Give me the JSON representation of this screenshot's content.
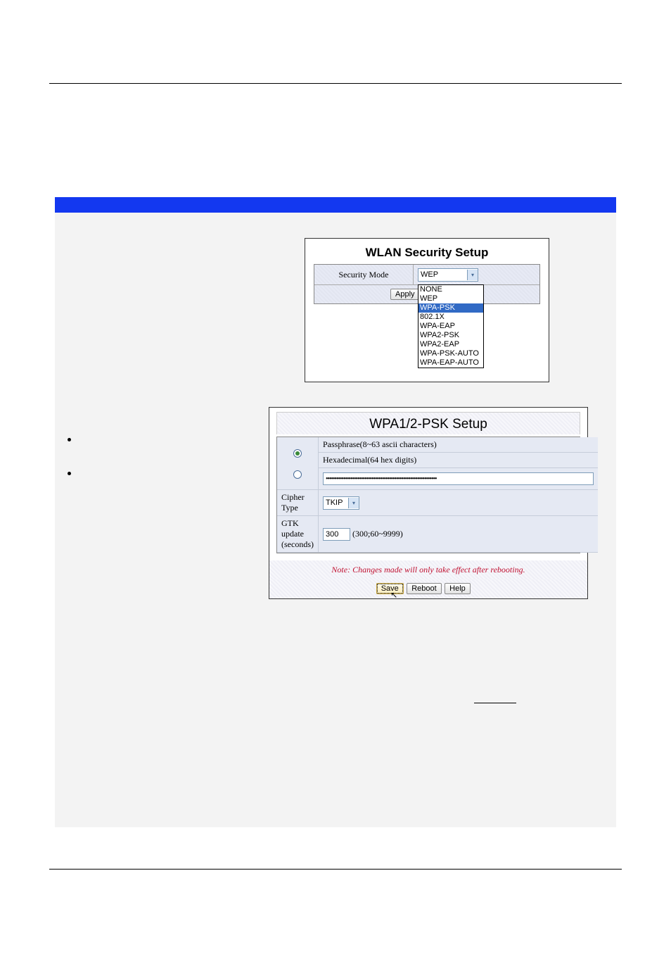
{
  "screenshot1": {
    "title": "WLAN Security Setup",
    "mode_label": "Security Mode",
    "selected": "WEP",
    "options": [
      "NONE",
      "WEP",
      "WPA-PSK",
      "802.1X",
      "WPA-EAP",
      "WPA2-PSK",
      "WPA2-EAP",
      "WPA-PSK-AUTO",
      "WPA-EAP-AUTO"
    ],
    "highlighted_option": "WPA-PSK",
    "apply_label": "Apply"
  },
  "screenshot2": {
    "title": "WPA1/2-PSK Setup",
    "passphrase_label": "Passphrase(8~63 ascii characters)",
    "hex_label": "Hexadecimal(64 hex digits)",
    "masked_value": "•••••••••••••••••••••••••••••••••••••••••••••••••••••••••••••••",
    "cipher_label": "Cipher Type",
    "cipher_value": "TKIP",
    "gtk_label": "GTK update (seconds)",
    "gtk_value": "300",
    "gtk_range": "(300;60~9999)",
    "note": "Note: Changes made will only take effect after rebooting.",
    "save_label": "Save",
    "reboot_label": "Reboot",
    "help_label": "Help"
  }
}
